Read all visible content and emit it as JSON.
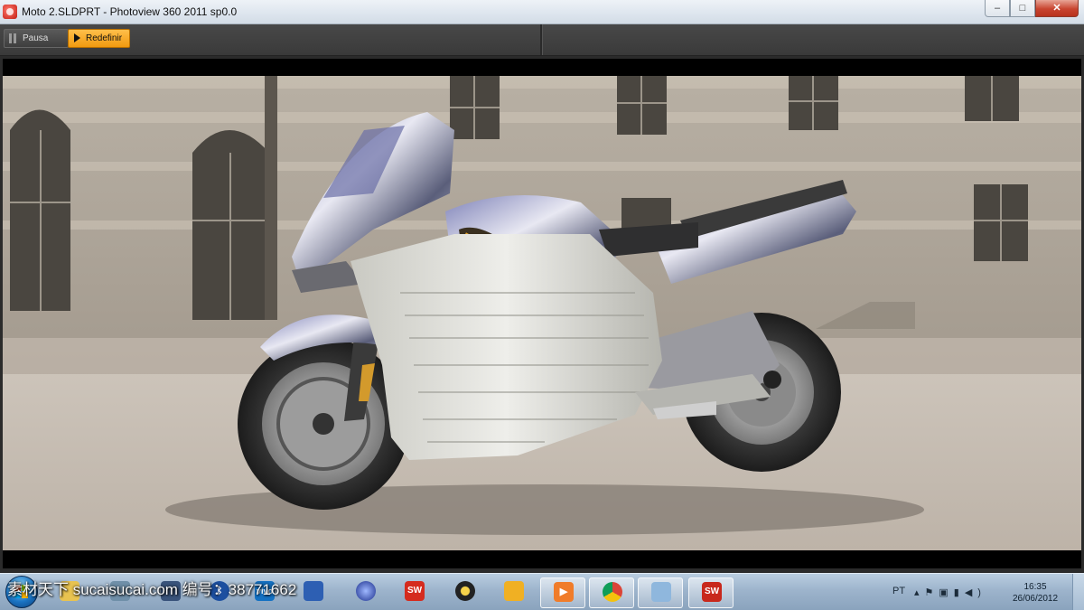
{
  "window": {
    "title": "Moto 2.SLDPRT - Photoview 360 2011 sp0.0",
    "minimize_glyph": "–",
    "maximize_glyph": "□",
    "close_glyph": "✕"
  },
  "toolbar": {
    "pause_label": "Pausa",
    "reset_label": "Redefinir",
    "accent_color": "#f5a623"
  },
  "render": {
    "subject": "motorcycle render in front of building facade"
  },
  "taskbar": {
    "watermark": "素材天下 sucaisucai.com   编号：38771662",
    "apps": [
      {
        "icon": "explorer-icon"
      },
      {
        "icon": "disk-icon"
      },
      {
        "icon": "security-icon"
      },
      {
        "icon": "bluetooth-icon"
      },
      {
        "icon": "vivo-icon"
      },
      {
        "icon": "cube-icon"
      },
      {
        "icon": "sphere-icon"
      },
      {
        "icon": "solidworks-icon"
      },
      {
        "icon": "dvd-icon"
      },
      {
        "icon": "game-icon"
      },
      {
        "icon": "media-player-icon"
      },
      {
        "icon": "chrome-icon"
      },
      {
        "icon": "paint-icon"
      },
      {
        "icon": "solidworks-active-icon"
      }
    ],
    "language": "PT",
    "clock_time": "16:35",
    "clock_date": "26/06/2012"
  }
}
